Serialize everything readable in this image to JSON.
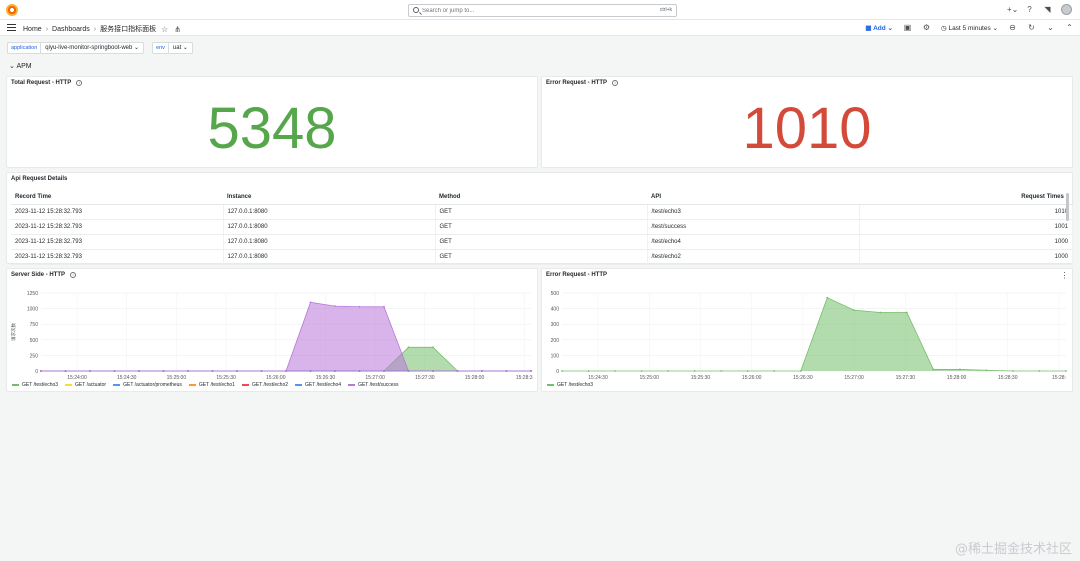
{
  "topbar": {
    "search_placeholder": "Search or jump to...",
    "search_shortcut": "ctrl+k",
    "icons": [
      "plus-icon",
      "help-icon",
      "news-icon",
      "avatar"
    ]
  },
  "navbar": {
    "breadcrumb": [
      "Home",
      "Dashboards",
      "服务接口指标面板"
    ],
    "add_label": "Add",
    "time_range": "Last 5 minutes"
  },
  "variables": [
    {
      "label": "application",
      "value": "qiyu-live-monitor-springboot-web"
    },
    {
      "label": "env",
      "value": "uat"
    }
  ],
  "row_title": "APM",
  "stats": {
    "total_request": {
      "title": "Total Request - HTTP",
      "value": "5348",
      "color": "#56a64b"
    },
    "error_request": {
      "title": "Error Request - HTTP",
      "value": "1010",
      "color": "#d44a3a"
    }
  },
  "table": {
    "title": "Api Request Details",
    "columns": [
      "Record Time",
      "Instance",
      "Method",
      "API",
      "Request Times"
    ],
    "rows": [
      [
        "2023-11-12 15:28:32.793",
        "127.0.0.1:8080",
        "GET",
        "/test/echo3",
        "1010"
      ],
      [
        "2023-11-12 15:28:32.793",
        "127.0.0.1:8080",
        "GET",
        "/test/success",
        "1001"
      ],
      [
        "2023-11-12 15:28:32.793",
        "127.0.0.1:8080",
        "GET",
        "/test/echo4",
        "1000"
      ],
      [
        "2023-11-12 15:28:32.793",
        "127.0.0.1:8080",
        "GET",
        "/test/echo2",
        "1000"
      ]
    ]
  },
  "server_chart_title": "Server Side - HTTP",
  "error_chart_title": "Error Request - HTTP",
  "chart_data": [
    {
      "type": "area",
      "title": "Server Side - HTTP",
      "ylabel": "请求次数",
      "ylim": [
        0,
        1250
      ],
      "yticks": [
        0,
        250,
        500,
        750,
        1000,
        1250
      ],
      "x": [
        "15:23:35",
        "15:23:50",
        "15:24:05",
        "15:24:20",
        "15:24:35",
        "15:24:50",
        "15:25:05",
        "15:25:20",
        "15:25:35",
        "15:25:50",
        "15:26:05",
        "15:26:20",
        "15:26:35",
        "15:26:50",
        "15:27:05",
        "15:27:20",
        "15:27:35",
        "15:27:50",
        "15:28:05",
        "15:28:20",
        "15:28:32"
      ],
      "xticks": [
        "15:24:00",
        "15:24:30",
        "15:25:00",
        "15:25:30",
        "15:26:00",
        "15:26:30",
        "15:27:00",
        "15:27:30",
        "15:28:00",
        "15:28:3"
      ],
      "series": [
        {
          "name": "GET /test/echo3",
          "color": "#73bf69",
          "values": [
            0,
            0,
            0,
            0,
            0,
            0,
            0,
            0,
            0,
            0,
            0,
            0,
            0,
            0,
            0,
            380,
            380,
            0,
            0,
            0,
            0
          ]
        },
        {
          "name": "GET /actuator",
          "color": "#fade2a",
          "values": [
            0,
            0,
            0,
            0,
            0,
            0,
            0,
            0,
            0,
            0,
            0,
            0,
            0,
            0,
            0,
            0,
            0,
            0,
            0,
            0,
            0
          ]
        },
        {
          "name": "GET /actuator/prometheus",
          "color": "#5794f2",
          "values": [
            0,
            0,
            0,
            0,
            0,
            0,
            0,
            0,
            0,
            0,
            0,
            0,
            0,
            0,
            0,
            0,
            0,
            0,
            0,
            0,
            0
          ]
        },
        {
          "name": "GET /test/echo1",
          "color": "#ff9830",
          "values": [
            0,
            0,
            0,
            0,
            0,
            0,
            0,
            0,
            0,
            0,
            0,
            0,
            0,
            0,
            0,
            0,
            0,
            0,
            0,
            0,
            0
          ]
        },
        {
          "name": "GET /test/echo2",
          "color": "#f2495c",
          "values": [
            0,
            0,
            0,
            0,
            0,
            0,
            0,
            0,
            0,
            0,
            0,
            0,
            0,
            0,
            0,
            0,
            0,
            0,
            0,
            0,
            0
          ]
        },
        {
          "name": "GET /test/echo4",
          "color": "#5794f2",
          "values": [
            0,
            0,
            0,
            0,
            0,
            0,
            0,
            0,
            0,
            0,
            0,
            0,
            0,
            0,
            0,
            0,
            0,
            0,
            0,
            0,
            0
          ]
        },
        {
          "name": "GET /test/success",
          "color": "#b877d9",
          "values": [
            0,
            0,
            0,
            0,
            0,
            0,
            0,
            0,
            0,
            0,
            0,
            1100,
            1040,
            1030,
            1030,
            0,
            0,
            0,
            0,
            0,
            0
          ]
        }
      ]
    },
    {
      "type": "area",
      "title": "Error Request - HTTP",
      "ylim": [
        0,
        500
      ],
      "yticks": [
        0,
        100,
        200,
        300,
        400,
        500
      ],
      "x": [
        "15:24:05",
        "15:24:20",
        "15:24:35",
        "15:24:50",
        "15:25:05",
        "15:25:20",
        "15:25:35",
        "15:25:50",
        "15:26:05",
        "15:26:20",
        "15:26:35",
        "15:26:50",
        "15:27:05",
        "15:27:20",
        "15:27:35",
        "15:27:50",
        "15:28:05",
        "15:28:20",
        "15:28:35",
        "15:28:50"
      ],
      "xticks": [
        "15:24:30",
        "15:25:00",
        "15:25:30",
        "15:26:00",
        "15:26:30",
        "15:27:00",
        "15:27:30",
        "15:28:00",
        "15:28:30",
        "15:28:"
      ],
      "series": [
        {
          "name": "GET /test/echo3",
          "color": "#73bf69",
          "values": [
            0,
            0,
            0,
            0,
            0,
            0,
            0,
            0,
            0,
            0,
            470,
            390,
            375,
            375,
            10,
            10,
            5,
            0,
            0,
            0
          ]
        }
      ]
    }
  ],
  "watermark": "@稀土掘金技术社区"
}
